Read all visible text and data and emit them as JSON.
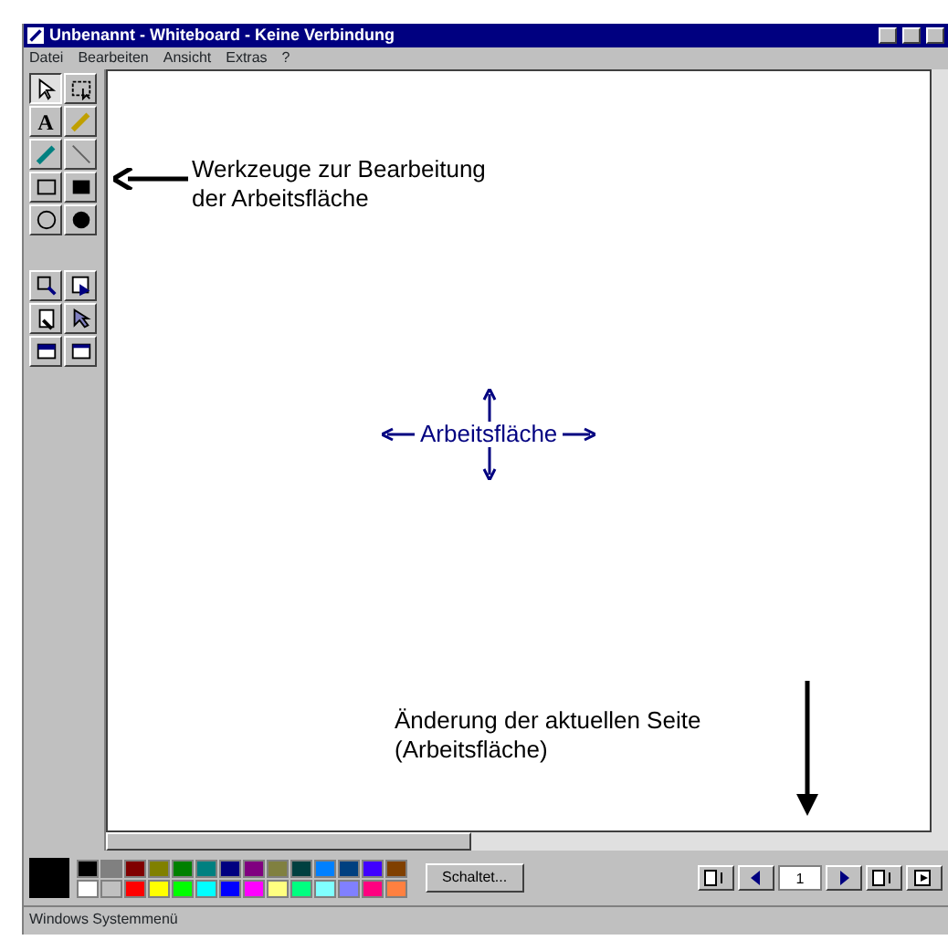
{
  "window": {
    "title": "Unbenannt - Whiteboard - Keine Verbindung"
  },
  "menu": [
    "Datei",
    "Bearbeiten",
    "Ansicht",
    "Extras",
    "?"
  ],
  "tools": [
    {
      "kind": "select",
      "selected": true
    },
    {
      "kind": "lasso",
      "selected": false
    },
    {
      "kind": "text",
      "label": "A",
      "selected": false
    },
    {
      "kind": "pen",
      "selected": false
    },
    {
      "kind": "highlighter",
      "selected": false
    },
    {
      "kind": "line",
      "selected": false
    },
    {
      "kind": "rect",
      "selected": false
    },
    {
      "kind": "filled-rect",
      "selected": false
    },
    {
      "kind": "ellipse",
      "selected": false
    },
    {
      "kind": "filled-ellipse",
      "selected": false
    },
    {
      "kind": "zoom",
      "selected": false
    },
    {
      "kind": "pointer",
      "selected": false
    },
    {
      "kind": "eraser",
      "selected": false
    },
    {
      "kind": "pointer2",
      "selected": false
    },
    {
      "kind": "window",
      "selected": false
    },
    {
      "kind": "window2",
      "selected": false
    }
  ],
  "annotations": [
    {
      "kind": "tools-note",
      "text": "Werkzeuge zur Bearbeitung der Arbeitsfläche"
    },
    {
      "kind": "center-note",
      "text": "Arbeitsfläche"
    },
    {
      "kind": "page-note",
      "text": "Änderung der aktuellen Seite (Arbeitsfläche)"
    }
  ],
  "palette": {
    "current": {
      "color": "#000000"
    },
    "swatches": [
      {
        "color": "#000000"
      },
      {
        "color": "#808080"
      },
      {
        "color": "#800000"
      },
      {
        "color": "#808000"
      },
      {
        "color": "#008000"
      },
      {
        "color": "#008080"
      },
      {
        "color": "#000080"
      },
      {
        "color": "#800080"
      },
      {
        "color": "#808040"
      },
      {
        "color": "#004040"
      },
      {
        "color": "#0080ff"
      },
      {
        "color": "#004080"
      },
      {
        "color": "#4000ff"
      },
      {
        "color": "#804000"
      },
      {
        "color": "#ffffff"
      },
      {
        "color": "#c0c0c0"
      },
      {
        "color": "#ff0000"
      },
      {
        "color": "#ffff00"
      },
      {
        "color": "#00ff00"
      },
      {
        "color": "#00ffff"
      },
      {
        "color": "#0000ff"
      },
      {
        "color": "#ff00ff"
      },
      {
        "color": "#ffff80"
      },
      {
        "color": "#00ff80"
      },
      {
        "color": "#80ffff"
      },
      {
        "color": "#8080ff"
      },
      {
        "color": "#ff0080"
      },
      {
        "color": "#ff8040"
      }
    ]
  },
  "lock_button": "Schaltet...",
  "page_nav": {
    "current": "1"
  },
  "status_bar": "Windows Systemmenü"
}
